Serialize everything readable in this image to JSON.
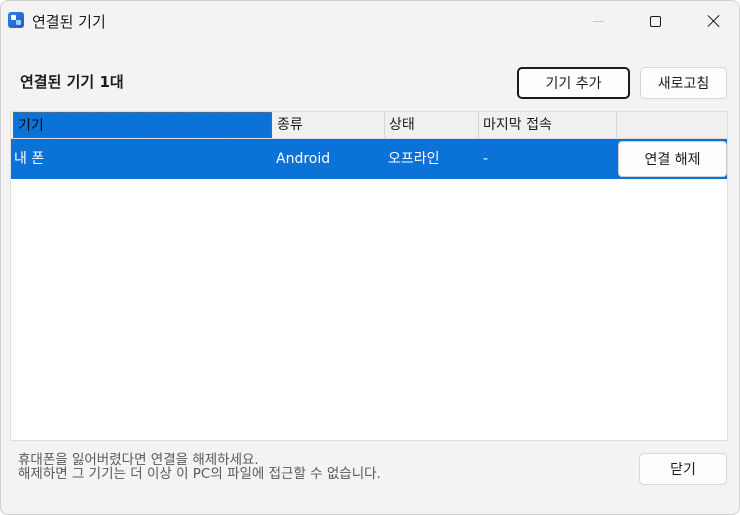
{
  "window": {
    "title": "연결된 기기"
  },
  "heading": "연결된 기기 1대",
  "toolbar": {
    "add_label": "기기 추가",
    "refresh_label": "새로고침"
  },
  "table": {
    "columns": [
      "기기",
      "종류",
      "상태",
      "마지막 접속",
      ""
    ],
    "rows": [
      {
        "device": "내 폰",
        "type": "Android",
        "status": "오프라인",
        "last_seen": "-",
        "action_label": "연결 해제"
      }
    ]
  },
  "footer": {
    "note_line1": "휴대폰을 잃어버렸다면 연결을 해제하세요.",
    "note_line2": "해제하면 그 기기는 더 이상 이 PC의 파일에 접근할 수 없습니다.",
    "close_label": "닫기"
  },
  "colors": {
    "accent": "#0b72d8",
    "window_bg": "#f3f3f3"
  }
}
